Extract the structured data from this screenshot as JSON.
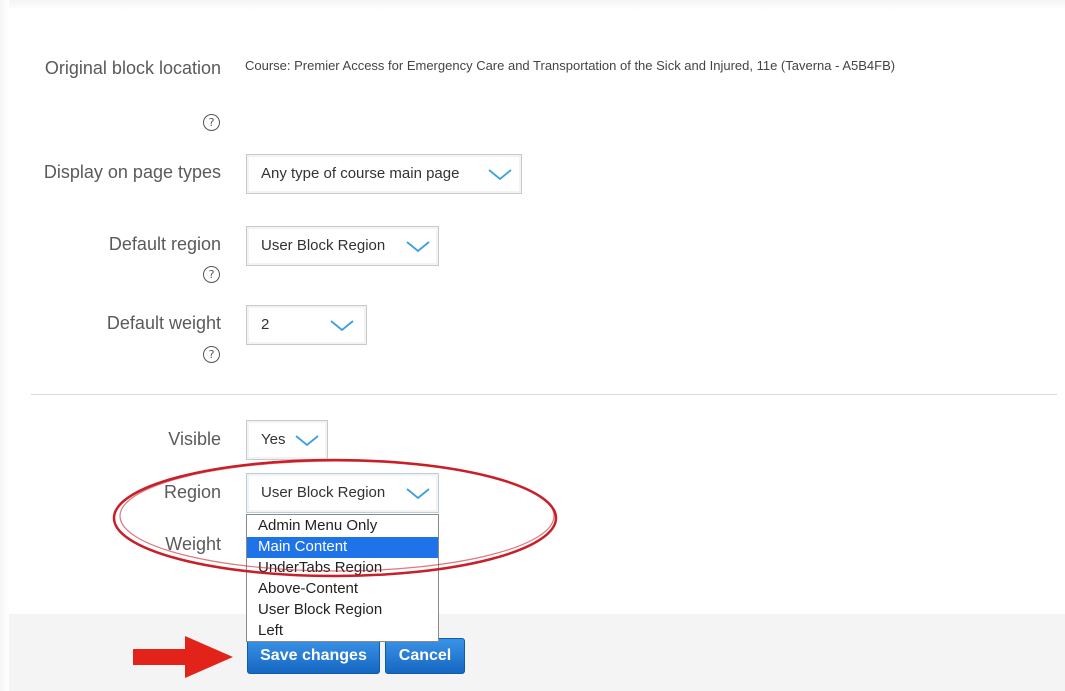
{
  "form": {
    "original_location": {
      "label": "Original block location",
      "value": "Course: Premier Access for Emergency Care and Transportation of the Sick and Injured, 11e (Taverna - A5B4FB)",
      "help_icon": "question-circle-icon"
    },
    "display_on_page_types": {
      "label": "Display on page types",
      "value": "Any type of course main page"
    },
    "default_region": {
      "label": "Default region",
      "value": "User Block Region",
      "help_icon": "question-circle-icon"
    },
    "default_weight": {
      "label": "Default weight",
      "value": "2",
      "help_icon": "question-circle-icon"
    },
    "visible": {
      "label": "Visible",
      "value": "Yes"
    },
    "region": {
      "label": "Region",
      "value": "User Block Region",
      "options": [
        "Admin Menu Only",
        "Main Content",
        "UnderTabs Region",
        "Above-Content",
        "User Block Region",
        "Left"
      ],
      "highlighted": "Main Content"
    },
    "weight": {
      "label": "Weight"
    }
  },
  "buttons": {
    "save": "Save changes",
    "cancel": "Cancel"
  },
  "colors": {
    "accent": "#1e73e8",
    "annotation": "#c8202a",
    "chevron": "#3aa0dd"
  },
  "icons": {
    "chevron": "chevron-down-icon",
    "help": "question-circle-icon",
    "annotation_arrow": "red-arrow"
  }
}
